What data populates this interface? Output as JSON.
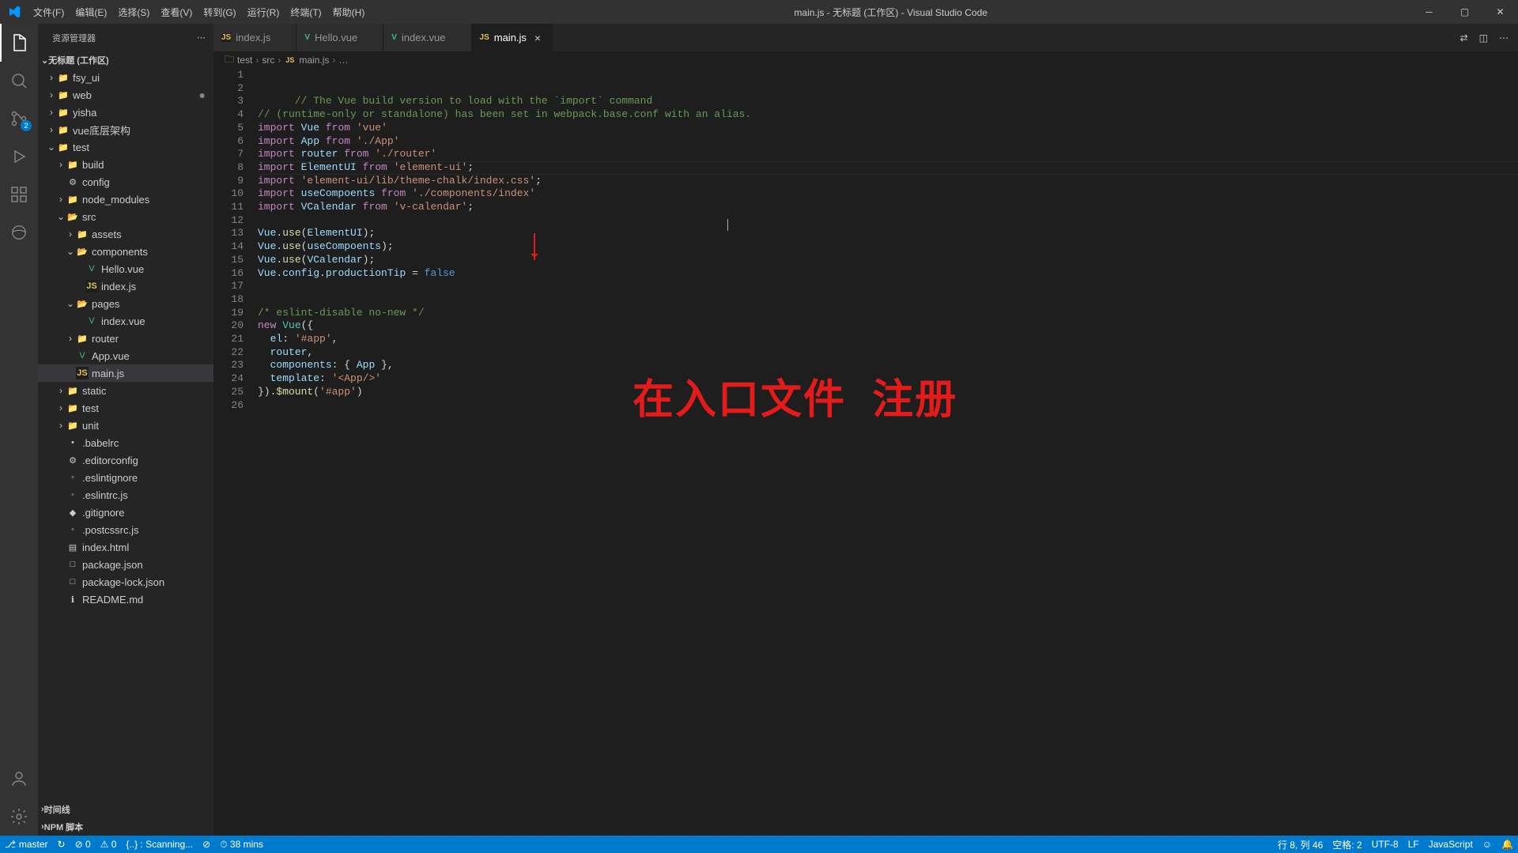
{
  "title": "main.js - 无标题 (工作区) - Visual Studio Code",
  "menu": [
    "文件(F)",
    "编辑(E)",
    "选择(S)",
    "查看(V)",
    "转到(G)",
    "运行(R)",
    "终端(T)",
    "帮助(H)"
  ],
  "sidebar": {
    "header": "资源管理器",
    "workspace": "无标题 (工作区)",
    "files": [
      {
        "d": 0,
        "chev": "›",
        "icon": "📁",
        "label": "fsy_ui"
      },
      {
        "d": 0,
        "chev": "›",
        "icon": "📁",
        "label": "web",
        "dot": true
      },
      {
        "d": 0,
        "chev": "›",
        "icon": "📁",
        "label": "yisha"
      },
      {
        "d": 0,
        "chev": "›",
        "icon": "📁",
        "label": "vue底层架构"
      },
      {
        "d": 0,
        "chev": "⌄",
        "icon": "📁",
        "label": "test"
      },
      {
        "d": 1,
        "chev": "›",
        "icon": "📁",
        "label": "build"
      },
      {
        "d": 1,
        "chev": "",
        "icon": "⚙",
        "label": "config"
      },
      {
        "d": 1,
        "chev": "›",
        "icon": "📁",
        "label": "node_modules"
      },
      {
        "d": 1,
        "chev": "⌄",
        "icon": "📂",
        "label": "src"
      },
      {
        "d": 2,
        "chev": "›",
        "icon": "📁",
        "label": "assets"
      },
      {
        "d": 2,
        "chev": "⌄",
        "icon": "📂",
        "label": "components"
      },
      {
        "d": 3,
        "chev": "",
        "icon": "V",
        "label": "Hello.vue",
        "vue": true
      },
      {
        "d": 3,
        "chev": "",
        "icon": "JS",
        "label": "index.js",
        "js": true
      },
      {
        "d": 2,
        "chev": "⌄",
        "icon": "📂",
        "label": "pages"
      },
      {
        "d": 3,
        "chev": "",
        "icon": "V",
        "label": "index.vue",
        "vue": true
      },
      {
        "d": 2,
        "chev": "›",
        "icon": "📁",
        "label": "router"
      },
      {
        "d": 2,
        "chev": "",
        "icon": "V",
        "label": "App.vue",
        "vue": true
      },
      {
        "d": 2,
        "chev": "",
        "icon": "JS",
        "label": "main.js",
        "js": true,
        "selected": true
      },
      {
        "d": 1,
        "chev": "›",
        "icon": "📁",
        "label": "static"
      },
      {
        "d": 1,
        "chev": "›",
        "icon": "📁",
        "label": "test"
      },
      {
        "d": 1,
        "chev": "›",
        "icon": "📁",
        "label": "unit"
      },
      {
        "d": 1,
        "chev": "",
        "icon": "•",
        "label": ".babelrc"
      },
      {
        "d": 1,
        "chev": "",
        "icon": "⚙",
        "label": ".editorconfig"
      },
      {
        "d": 1,
        "chev": "",
        "icon": "◦",
        "label": ".eslintignore"
      },
      {
        "d": 1,
        "chev": "",
        "icon": "◦",
        "label": ".eslintrc.js"
      },
      {
        "d": 1,
        "chev": "",
        "icon": "◆",
        "label": ".gitignore"
      },
      {
        "d": 1,
        "chev": "",
        "icon": "◦",
        "label": ".postcssrc.js"
      },
      {
        "d": 1,
        "chev": "",
        "icon": "▤",
        "label": "index.html"
      },
      {
        "d": 1,
        "chev": "",
        "icon": "□",
        "label": "package.json"
      },
      {
        "d": 1,
        "chev": "",
        "icon": "□",
        "label": "package-lock.json"
      },
      {
        "d": 1,
        "chev": "",
        "icon": "ℹ",
        "label": "README.md"
      }
    ],
    "panels": [
      "时间线",
      "NPM 脚本"
    ]
  },
  "tabs": [
    {
      "icon": "JS",
      "label": "index.js"
    },
    {
      "icon": "V",
      "label": "Hello.vue",
      "vue": true
    },
    {
      "icon": "V",
      "label": "index.vue",
      "vue": true
    },
    {
      "icon": "JS",
      "label": "main.js",
      "active": true
    }
  ],
  "breadcrumb": [
    "test",
    "src",
    "main.js",
    "…"
  ],
  "breadcrumb_icons": [
    "📁",
    "",
    "JS",
    ""
  ],
  "overlay": "在入口文件 注册",
  "status": {
    "branch": "master",
    "sync": "↻",
    "errors": "⊘ 0",
    "warnings": "⚠ 0",
    "scanning": "{..} : Scanning...",
    "live": "⊘",
    "time": "⏱ 38 mins",
    "pos": "行 8, 列 46",
    "spaces": "空格: 2",
    "enc": "UTF-8",
    "eol": "LF",
    "lang": "JavaScript",
    "feedback": "☺",
    "bell": "🔔"
  },
  "scm_badge": "2",
  "code": {
    "lines": 26
  }
}
